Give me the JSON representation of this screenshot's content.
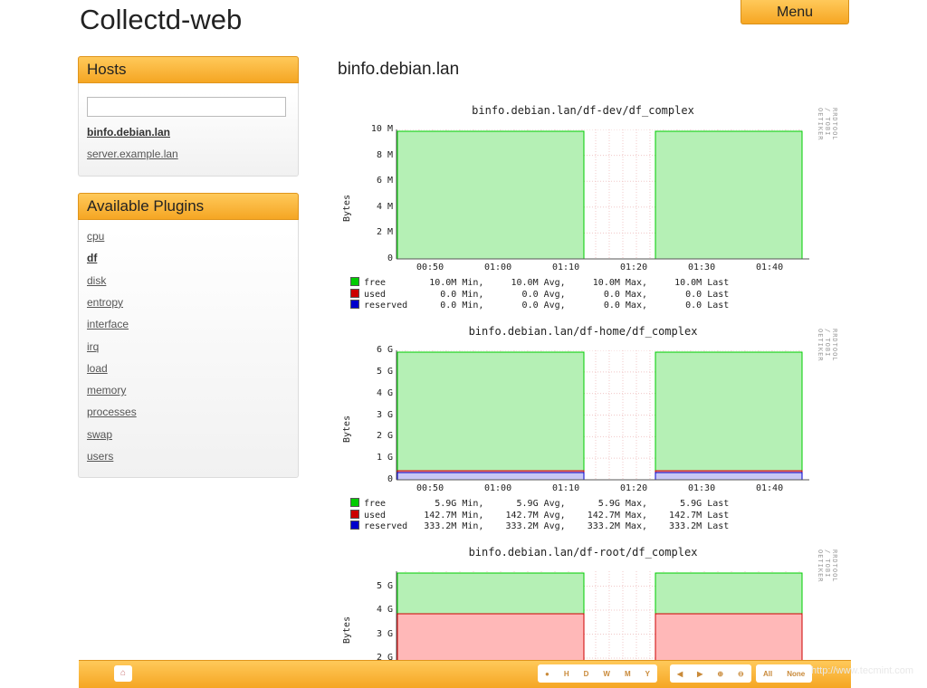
{
  "app": {
    "title": "Collectd-web",
    "menu_label": "Menu"
  },
  "hosts": {
    "heading": "Hosts",
    "search_value": "",
    "items": [
      {
        "label": "binfo.debian.lan",
        "active": true
      },
      {
        "label": "server.example.lan",
        "active": false
      }
    ]
  },
  "plugins": {
    "heading": "Available Plugins",
    "items": [
      {
        "label": "cpu",
        "active": false
      },
      {
        "label": "df",
        "active": true
      },
      {
        "label": "disk",
        "active": false
      },
      {
        "label": "entropy",
        "active": false
      },
      {
        "label": "interface",
        "active": false
      },
      {
        "label": "irq",
        "active": false
      },
      {
        "label": "load",
        "active": false
      },
      {
        "label": "memory",
        "active": false
      },
      {
        "label": "processes",
        "active": false
      },
      {
        "label": "swap",
        "active": false
      },
      {
        "label": "users",
        "active": false
      }
    ]
  },
  "main": {
    "heading": "binfo.debian.lan"
  },
  "graphs": [
    {
      "title": "binfo.debian.lan/df-dev/df_complex",
      "ylabel": "Bytes",
      "side": "RRDTOOL / TOBI OETIKER",
      "yticks": [
        "10 M",
        "8 M",
        "6 M",
        "4 M",
        "2 M",
        "0"
      ],
      "xticks": [
        "00:50",
        "01:00",
        "01:10",
        "01:20",
        "01:30",
        "01:40"
      ],
      "legend": [
        {
          "name": "free",
          "min": "10.0M",
          "avg": "10.0M",
          "max": "10.0M",
          "last": "10.0M"
        },
        {
          "name": "used",
          "min": "0.0",
          "avg": "0.0",
          "max": "0.0",
          "last": "0.0"
        },
        {
          "name": "reserved",
          "min": "0.0",
          "avg": "0.0",
          "max": "0.0",
          "last": "0.0"
        }
      ]
    },
    {
      "title": "binfo.debian.lan/df-home/df_complex",
      "ylabel": "Bytes",
      "side": "RRDTOOL / TOBI OETIKER",
      "yticks": [
        "6 G",
        "5 G",
        "4 G",
        "3 G",
        "2 G",
        "1 G",
        "0"
      ],
      "xticks": [
        "00:50",
        "01:00",
        "01:10",
        "01:20",
        "01:30",
        "01:40"
      ],
      "legend": [
        {
          "name": "free",
          "min": "5.9G",
          "avg": "5.9G",
          "max": "5.9G",
          "last": "5.9G"
        },
        {
          "name": "used",
          "min": "142.7M",
          "avg": "142.7M",
          "max": "142.7M",
          "last": "142.7M"
        },
        {
          "name": "reserved",
          "min": "333.2M",
          "avg": "333.2M",
          "max": "333.2M",
          "last": "333.2M"
        }
      ]
    },
    {
      "title": "binfo.debian.lan/df-root/df_complex",
      "ylabel": "Bytes",
      "side": "RRDTOOL / TOBI OETIKER",
      "yticks": [
        "5 G",
        "4 G",
        "3 G",
        "2 G"
      ],
      "xticks": [],
      "legend": []
    }
  ],
  "labels": {
    "min": "Min,",
    "avg": "Avg,",
    "max": "Max,",
    "last": "Last"
  },
  "colors": {
    "free": "#00cc00",
    "used": "#cc0000",
    "reserved": "#0000cc",
    "accent": "#f5a623"
  },
  "bottombar": {
    "home_icon": "home-icon",
    "groups": [
      [
        "clock-icon",
        "H",
        "D",
        "W",
        "M",
        "Y"
      ],
      [
        "prev-icon",
        "next-icon",
        "zoom-in-icon",
        "zoom-out-icon"
      ],
      [
        "All",
        "None"
      ]
    ]
  },
  "watermark": "http://www.tecmint.com"
}
